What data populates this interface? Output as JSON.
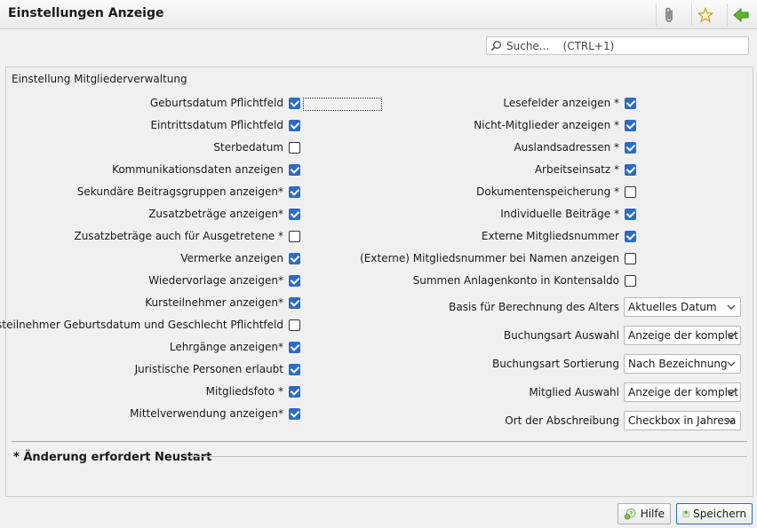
{
  "titlebar": {
    "title": "Einstellungen Anzeige",
    "icons": [
      "paperclip-icon",
      "star-icon",
      "back-arrow-icon"
    ]
  },
  "search": {
    "placeholder": "Suche...    (CTRL+1)"
  },
  "section": {
    "title": "Einstellung Mitgliederverwaltung"
  },
  "left_settings": [
    {
      "label": "Geburtsdatum Pflichtfeld",
      "checked": true
    },
    {
      "label": "Eintrittsdatum Pflichtfeld",
      "checked": true
    },
    {
      "label": "Sterbedatum",
      "checked": false
    },
    {
      "label": "Kommunikationsdaten anzeigen",
      "checked": true
    },
    {
      "label": "Sekundäre Beitragsgruppen anzeigen*",
      "checked": true
    },
    {
      "label": "Zusatzbeträge anzeigen*",
      "checked": true
    },
    {
      "label": "Zusatzbeträge auch für Ausgetretene *",
      "checked": false
    },
    {
      "label": "Vermerke anzeigen",
      "checked": true
    },
    {
      "label": "Wiedervorlage anzeigen*",
      "checked": true
    },
    {
      "label": "Kursteilnehmer anzeigen*",
      "checked": true
    },
    {
      "label": "Kursteilnehmer Geburtsdatum und Geschlecht Pflichtfeld",
      "checked": false
    },
    {
      "label": "Lehrgänge anzeigen*",
      "checked": true
    },
    {
      "label": "Juristische Personen erlaubt",
      "checked": true
    },
    {
      "label": "Mitgliedsfoto *",
      "checked": true
    },
    {
      "label": "Mittelverwendung anzeigen*",
      "checked": true
    }
  ],
  "right_settings": [
    {
      "label": "Lesefelder anzeigen *",
      "checked": true
    },
    {
      "label": "Nicht-Mitglieder anzeigen *",
      "checked": true
    },
    {
      "label": "Auslandsadressen *",
      "checked": true
    },
    {
      "label": "Arbeitseinsatz *",
      "checked": true
    },
    {
      "label": "Dokumentenspeicherung *",
      "checked": false
    },
    {
      "label": "Individuelle Beiträge *",
      "checked": true
    },
    {
      "label": "Externe Mitgliedsnummer",
      "checked": true
    },
    {
      "label": "(Externe) Mitgliedsnummer bei Namen anzeigen",
      "checked": false
    },
    {
      "label": "Summen Anlagenkonto in Kontensaldo",
      "checked": false
    }
  ],
  "dropdowns": [
    {
      "label": "Basis für Berechnung des Alters",
      "value": "Aktuelles Datum"
    },
    {
      "label": "Buchungsart Auswahl",
      "value": "Anzeige der komplet"
    },
    {
      "label": "Buchungsart Sortierung",
      "value": "Nach Bezeichnung"
    },
    {
      "label": "Mitglied Auswahl",
      "value": "Anzeige der komplet"
    },
    {
      "label": "Ort der Abschreibung",
      "value": "Checkbox in Jahresa"
    }
  ],
  "note": "* Änderung erfordert Neustart",
  "buttons": {
    "help": "Hilfe",
    "save": "Speichern"
  },
  "colors": {
    "checkbox_on": "#2a6cc7",
    "primary_border": "#2f6db5"
  }
}
